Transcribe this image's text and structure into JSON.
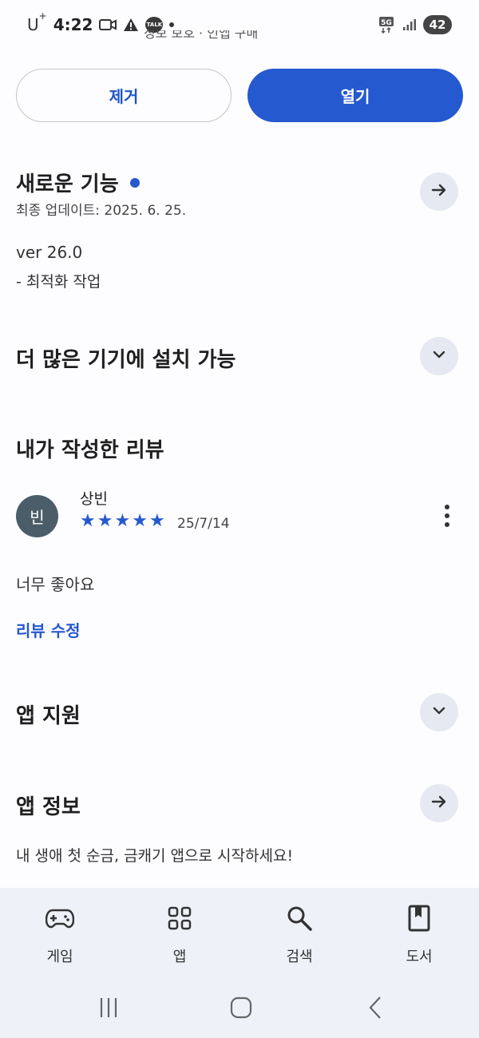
{
  "status_bar": {
    "carrier": "U",
    "carrier_sup": "+",
    "time": "4:22",
    "talk_badge": "TALK",
    "network": "5G",
    "battery": "42"
  },
  "clipped_header": "정보 보호 · 인앱 구매",
  "actions": {
    "remove_label": "제거",
    "open_label": "열기"
  },
  "whats_new": {
    "title": "새로운 기능",
    "updated": "최종 업데이트: 2025. 6. 25.",
    "version": "ver 26.0",
    "note": "- 최적화 작업"
  },
  "more_devices": {
    "title": "더 많은 기기에 설치 가능"
  },
  "my_review": {
    "title": "내가 작성한 리뷰",
    "avatar_initial": "빈",
    "reviewer": "상빈",
    "rating": 5,
    "stars": [
      "★",
      "★",
      "★",
      "★",
      "★"
    ],
    "date": "25/7/14",
    "text": "너무 좋아요",
    "edit_label": "리뷰 수정"
  },
  "app_support": {
    "title": "앱 지원"
  },
  "app_info": {
    "title": "앱 정보",
    "description": "내 생애 첫 순금, 금캐기 앱으로 시작하세요!"
  },
  "bottom_nav": {
    "items": [
      {
        "label": "게임",
        "icon": "gamepad-icon"
      },
      {
        "label": "앱",
        "icon": "apps-grid-icon"
      },
      {
        "label": "검색",
        "icon": "search-icon"
      },
      {
        "label": "도서",
        "icon": "book-icon"
      }
    ]
  },
  "colors": {
    "accent": "#2559cf",
    "circle_button": "#e6e9f1",
    "nav_background": "#eef1f8",
    "avatar": "#4b5d68"
  }
}
